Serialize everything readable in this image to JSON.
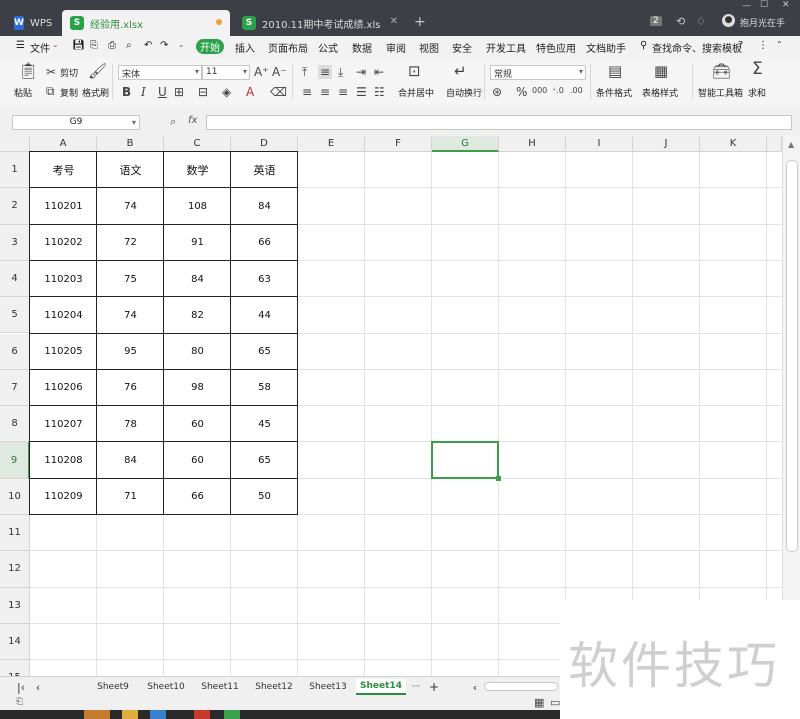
{
  "titlebar": {
    "app_tab": "WPS",
    "tabs": [
      {
        "label": "经验用.xlsx",
        "active": true
      },
      {
        "label": "2010.11期中考试成绩.xls",
        "active": false
      }
    ],
    "badge": "2",
    "user": "抱月光在手"
  },
  "menu": {
    "file": "文件",
    "start": "开始",
    "items": [
      "插入",
      "页面布局",
      "公式",
      "数据",
      "审阅",
      "视图",
      "安全",
      "开发工具",
      "特色应用",
      "文档助手"
    ],
    "search": "查找命令、搜索模板",
    "help": "?"
  },
  "ribbon": {
    "paste": "粘贴",
    "cut": "剪切",
    "copy": "复制",
    "format_painter": "格式刷",
    "font_name": "宋体",
    "font_size": "11",
    "bold": "B",
    "italic": "I",
    "underline": "U",
    "merge_center": "合并居中",
    "wrap_text": "自动换行",
    "number_format": "常规",
    "percent": "%",
    "thousands": "000",
    "conditional_format": "条件格式",
    "table_style": "表格样式",
    "smart_toolbox": "智能工具箱",
    "sum": "求和",
    "font_grow": "A⁺",
    "font_shrink": "A⁻"
  },
  "formula_bar": {
    "name_box": "G9",
    "fx": "fx",
    "value": ""
  },
  "sheet": {
    "columns": [
      "A",
      "B",
      "C",
      "D",
      "E",
      "F",
      "G",
      "H",
      "I",
      "J",
      "K"
    ],
    "rows": [
      "1",
      "2",
      "3",
      "4",
      "5",
      "6",
      "7",
      "8",
      "9",
      "10",
      "11",
      "12",
      "13",
      "14",
      "15"
    ],
    "selected_cell": "G9",
    "table": {
      "headers": [
        "考号",
        "语文",
        "数学",
        "英语"
      ],
      "records": [
        [
          "110201",
          "74",
          "108",
          "84"
        ],
        [
          "110202",
          "72",
          "91",
          "66"
        ],
        [
          "110203",
          "75",
          "84",
          "63"
        ],
        [
          "110204",
          "74",
          "82",
          "44"
        ],
        [
          "110205",
          "95",
          "80",
          "65"
        ],
        [
          "110206",
          "76",
          "98",
          "58"
        ],
        [
          "110207",
          "78",
          "60",
          "45"
        ],
        [
          "110208",
          "84",
          "60",
          "65"
        ],
        [
          "110209",
          "71",
          "66",
          "50"
        ]
      ]
    }
  },
  "sheet_tabs": {
    "tabs": [
      "Sheet9",
      "Sheet10",
      "Sheet11",
      "Sheet12",
      "Sheet13",
      "Sheet14"
    ],
    "active": "Sheet14",
    "more": "···",
    "add": "+"
  },
  "watermark": "软件技巧"
}
